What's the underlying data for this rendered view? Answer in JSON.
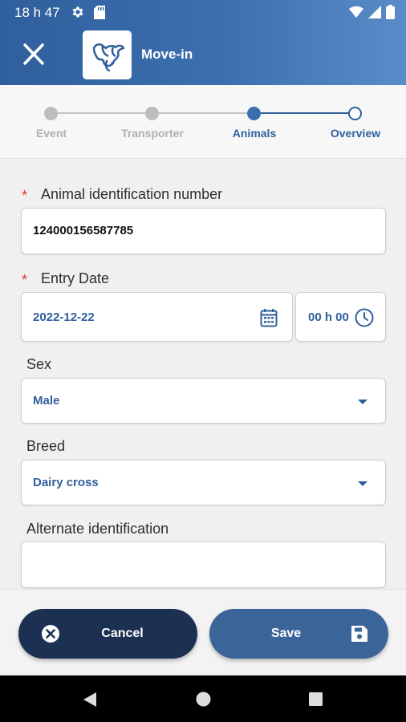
{
  "status_bar": {
    "time": "18 h 47",
    "icons": [
      "gear-icon",
      "sd-card-icon",
      "wifi-icon",
      "signal-icon",
      "battery-icon"
    ]
  },
  "app_bar": {
    "title": "Move-in",
    "close_icon": "close-icon",
    "logo_icon": "cow-logo-icon"
  },
  "stepper": {
    "steps": [
      {
        "label": "Event",
        "state": "done"
      },
      {
        "label": "Transporter",
        "state": "done"
      },
      {
        "label": "Animals",
        "state": "active"
      },
      {
        "label": "Overview",
        "state": "pending"
      }
    ]
  },
  "form": {
    "animal_id": {
      "label": "Animal identification number",
      "required": true,
      "value": "124000156587785"
    },
    "entry_date": {
      "label": "Entry Date",
      "required": true,
      "date": "2022-12-22",
      "time": "00 h 00"
    },
    "sex": {
      "label": "Sex",
      "value": "Male"
    },
    "breed": {
      "label": "Breed",
      "value": "Dairy cross"
    },
    "alt_id": {
      "label": "Alternate identification",
      "value": ""
    },
    "required_marker": "*"
  },
  "actions": {
    "cancel_label": "Cancel",
    "save_label": "Save"
  },
  "colors": {
    "primary": "#2f5f9c",
    "dark_button": "#1c3052",
    "save_button": "#3b6499",
    "required": "#e53935",
    "inactive_step": "#b5b5b5"
  }
}
